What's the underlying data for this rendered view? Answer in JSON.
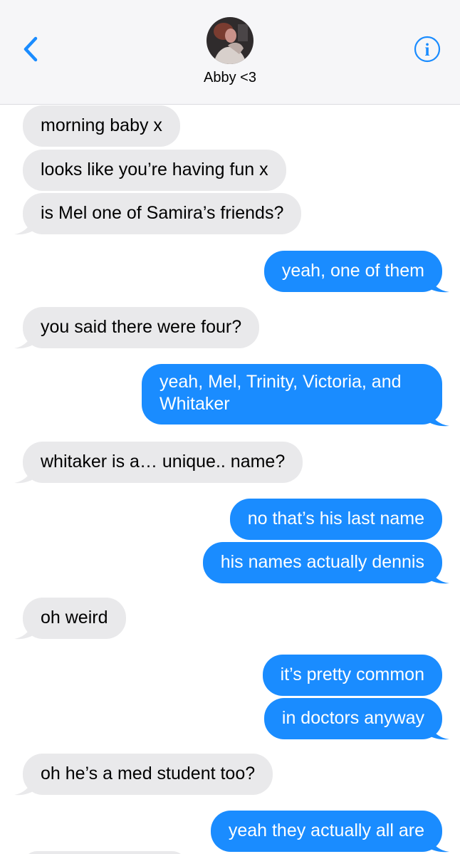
{
  "header": {
    "contact_name": "Abby <3",
    "back_icon": "chevron-left-icon",
    "info_icon": "info-icon",
    "accent_color": "#1a8cff"
  },
  "messages": [
    {
      "direction": "incoming",
      "text": "morning baby x"
    },
    {
      "direction": "incoming",
      "text": "looks like you’re having fun x"
    },
    {
      "direction": "incoming",
      "text": "is Mel one of Samira’s friends?"
    },
    {
      "direction": "outgoing",
      "text": "yeah, one of them"
    },
    {
      "direction": "incoming",
      "text": "you said there were four?"
    },
    {
      "direction": "outgoing",
      "lines": [
        "yeah, Mel, Trinity, Victoria, and",
        "Whitaker"
      ]
    },
    {
      "direction": "incoming",
      "text": "whitaker is a… unique.. name?"
    },
    {
      "direction": "outgoing",
      "text": "no that’s his last name"
    },
    {
      "direction": "outgoing",
      "text": "his names actually dennis"
    },
    {
      "direction": "incoming",
      "text": "oh weird"
    },
    {
      "direction": "outgoing",
      "text": "it’s pretty common"
    },
    {
      "direction": "outgoing",
      "text": "in doctors anyway"
    },
    {
      "direction": "incoming",
      "text": "oh he’s a med student too?"
    },
    {
      "direction": "outgoing",
      "text": "yeah they actually all are"
    }
  ]
}
